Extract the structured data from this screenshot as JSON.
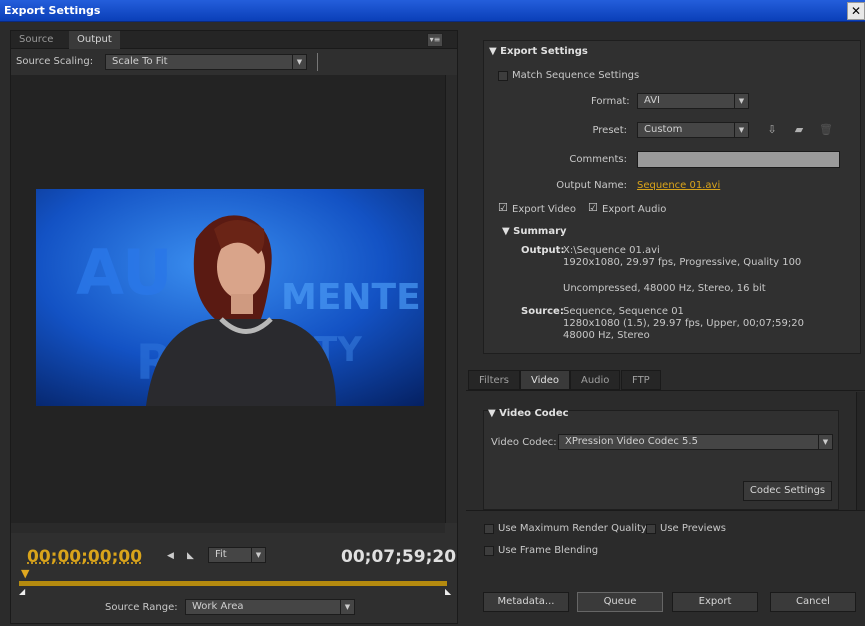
{
  "window": {
    "title": "Export Settings",
    "close_glyph": "✕"
  },
  "left": {
    "tabs": [
      {
        "label": "Source"
      },
      {
        "label": "Output"
      }
    ],
    "source_scaling": {
      "label": "Source Scaling:",
      "value": "Scale To Fit"
    },
    "video_overlay_text": {
      "l1": "AU",
      "l2": "MENTED",
      "l3": "R",
      "l4": "TY"
    },
    "current_time": "00;00;00;00",
    "zoom": {
      "value": "Fit"
    },
    "duration": "00;07;59;20",
    "source_range": {
      "label": "Source Range:",
      "value": "Work Area"
    }
  },
  "export_settings": {
    "section_title": "Export Settings",
    "match_sequence": "Match Sequence Settings",
    "format": {
      "label": "Format:",
      "value": "AVI"
    },
    "preset": {
      "label": "Preset:",
      "value": "Custom"
    },
    "comments": {
      "label": "Comments:",
      "value": ""
    },
    "output_name": {
      "label": "Output Name:",
      "value": "Sequence 01.avi"
    },
    "export_video": "Export Video",
    "export_audio": "Export Audio",
    "summary": {
      "title": "Summary",
      "output_label": "Output:",
      "output_lines": [
        "X:\\Sequence 01.avi",
        "1920x1080, 29.97 fps, Progressive, Quality 100",
        "Uncompressed, 48000 Hz, Stereo, 16 bit"
      ],
      "source_label": "Source:",
      "source_lines": [
        "Sequence, Sequence 01",
        "1280x1080 (1.5), 29.97 fps, Upper, 00;07;59;20",
        "48000 Hz, Stereo"
      ]
    }
  },
  "right_tabs": [
    {
      "label": "Filters"
    },
    {
      "label": "Video"
    },
    {
      "label": "Audio"
    },
    {
      "label": "FTP"
    }
  ],
  "video_codec": {
    "section_title": "Video Codec",
    "label": "Video Codec:",
    "value": "XPression Video Codec 5.5",
    "settings_button": "Codec Settings"
  },
  "options": {
    "max_render": "Use Maximum Render Quality",
    "previews": "Use Previews",
    "frame_blending": "Use Frame Blending"
  },
  "buttons": {
    "metadata": "Metadata...",
    "queue": "Queue",
    "export": "Export",
    "cancel": "Cancel"
  },
  "colors": {
    "accent_time": "#d9a41b",
    "titlebar": "#0a3fb8"
  }
}
